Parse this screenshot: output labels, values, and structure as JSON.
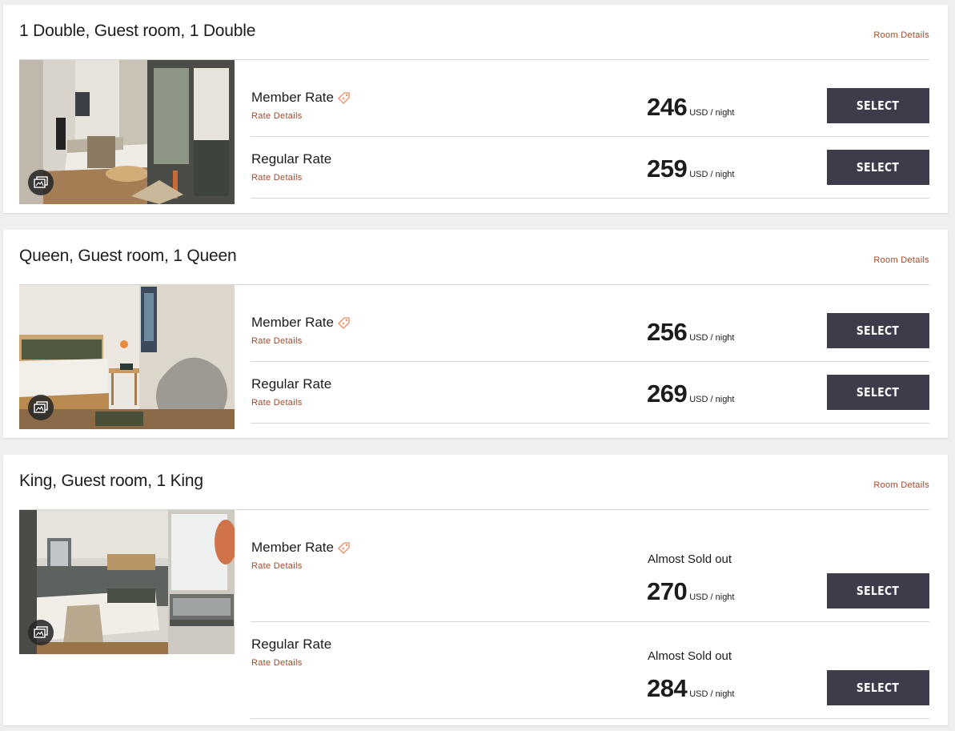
{
  "rooms": [
    {
      "title": "1 Double, Guest room, 1 Double",
      "room_details_label": "Room Details",
      "photo": "room-photo-double",
      "rates": [
        {
          "name": "Member Rate",
          "details_label": "Rate Details",
          "price": "246",
          "unit": "USD / night",
          "select_label": "SELECT",
          "member_tag": true
        },
        {
          "name": "Regular Rate",
          "details_label": "Rate Details",
          "price": "259",
          "unit": "USD / night",
          "select_label": "SELECT",
          "member_tag": false
        }
      ]
    },
    {
      "title": "Queen, Guest room, 1 Queen",
      "room_details_label": "Room Details",
      "photo": "room-photo-queen",
      "rates": [
        {
          "name": "Member Rate",
          "details_label": "Rate Details",
          "price": "256",
          "unit": "USD / night",
          "select_label": "SELECT",
          "member_tag": true
        },
        {
          "name": "Regular Rate",
          "details_label": "Rate Details",
          "price": "269",
          "unit": "USD / night",
          "select_label": "SELECT",
          "member_tag": false
        }
      ]
    },
    {
      "title": "King, Guest room, 1 King",
      "room_details_label": "Room Details",
      "photo": "room-photo-king",
      "rates": [
        {
          "name": "Member Rate",
          "details_label": "Rate Details",
          "availability": "Almost Sold out",
          "price": "270",
          "unit": "USD / night",
          "select_label": "SELECT",
          "member_tag": true
        },
        {
          "name": "Regular Rate",
          "details_label": "Rate Details",
          "availability": "Almost Sold out",
          "price": "284",
          "unit": "USD / night",
          "select_label": "SELECT",
          "member_tag": false
        }
      ]
    }
  ],
  "icons": {
    "member_rate": "price-tag-icon",
    "gallery": "image-gallery-icon"
  },
  "colors": {
    "accent_link": "#a2492a",
    "tag_icon": "#f08a5d",
    "button_bg": "#3f3b4b",
    "button_text": "#ffffff",
    "page_bg": "#efefef"
  }
}
